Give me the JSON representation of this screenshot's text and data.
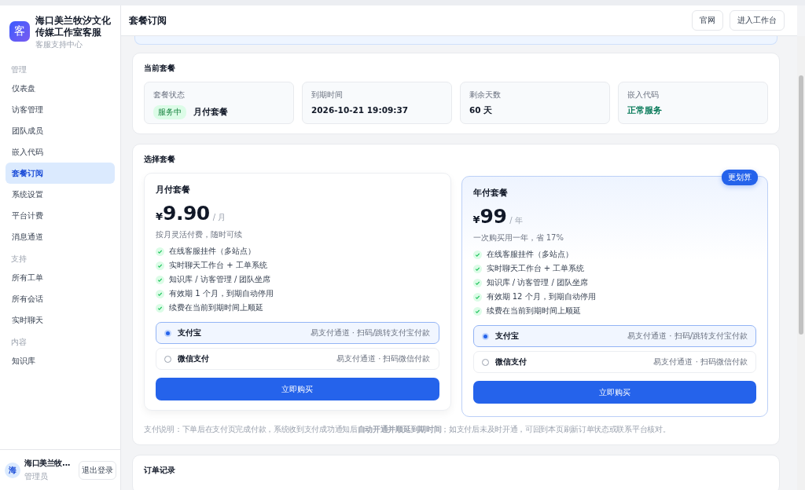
{
  "brand": {
    "logo": "客",
    "name": "海口美兰牧汐文化传媒工作室客服",
    "subtitle": "客服支持中心"
  },
  "sidebar": {
    "sections": [
      {
        "label": "管理",
        "items": [
          {
            "label": "仪表盘",
            "selected": false
          },
          {
            "label": "访客管理",
            "selected": false
          },
          {
            "label": "团队成员",
            "selected": false
          },
          {
            "label": "嵌入代码",
            "selected": false
          },
          {
            "label": "套餐订阅",
            "selected": true
          },
          {
            "label": "系统设置",
            "selected": false
          },
          {
            "label": "平台计费",
            "selected": false
          },
          {
            "label": "消息通道",
            "selected": false
          }
        ]
      },
      {
        "label": "支持",
        "items": [
          {
            "label": "所有工单",
            "selected": false
          },
          {
            "label": "所有会话",
            "selected": false
          },
          {
            "label": "实时聊天",
            "selected": false
          }
        ]
      },
      {
        "label": "内容",
        "items": [
          {
            "label": "知识库",
            "selected": false
          }
        ]
      }
    ],
    "user": {
      "avatar": "海",
      "name": "海口美兰牧...",
      "role": "管理员",
      "logout": "退出登录"
    }
  },
  "header": {
    "title": "套餐订阅",
    "buttons": [
      "官网",
      "进入工作台"
    ]
  },
  "current_plan": {
    "title": "当前套餐",
    "stats": [
      {
        "label": "套餐状态",
        "badge": "服务中",
        "value": "月付套餐",
        "kind": "badge"
      },
      {
        "label": "到期时间",
        "value": "2026-10-21 19:09:37",
        "kind": "plain"
      },
      {
        "label": "剩余天数",
        "value": "60 天",
        "kind": "plain"
      },
      {
        "label": "嵌入代码",
        "value": "正常服务",
        "kind": "success"
      }
    ]
  },
  "choose_plan": {
    "title": "选择套餐",
    "plans": [
      {
        "name": "月付套餐",
        "currency": "¥",
        "price": "9.90",
        "unit": "/ 月",
        "note": "按月灵活付费，随时可续",
        "featured": false,
        "features": [
          "在线客服挂件（多站点）",
          "实时聊天工作台 + 工单系统",
          "知识库 / 访客管理 / 团队坐席",
          "有效期 1 个月，到期自动停用",
          "续费在当前到期时间上顺延"
        ],
        "payments": [
          {
            "name": "支付宝",
            "desc": "易支付通道 · 扫码/跳转支付宝付款",
            "selected": true
          },
          {
            "name": "微信支付",
            "desc": "易支付通道 · 扫码微信付款",
            "selected": false
          }
        ],
        "buy": "立即购买"
      },
      {
        "name": "年付套餐",
        "currency": "¥",
        "price": "99",
        "unit": "/ 年",
        "note": "一次购买用一年，省 17%",
        "featured": true,
        "badge": "更划算",
        "features": [
          "在线客服挂件（多站点）",
          "实时聊天工作台 + 工单系统",
          "知识库 / 访客管理 / 团队坐席",
          "有效期 12 个月，到期自动停用",
          "续费在当前到期时间上顺延"
        ],
        "payments": [
          {
            "name": "支付宝",
            "desc": "易支付通道 · 扫码/跳转支付宝付款",
            "selected": true
          },
          {
            "name": "微信支付",
            "desc": "易支付通道 · 扫码微信付款",
            "selected": false
          }
        ],
        "buy": "立即购买"
      }
    ],
    "footnote": "支付说明：下单后在支付页完成付款，系统收到支付成功通知后**自动开通并顺延到期时间**；如支付后未及时开通，可回到本页刷新订单状态或联系平台核对。"
  },
  "orders": {
    "title": "订单记录"
  }
}
